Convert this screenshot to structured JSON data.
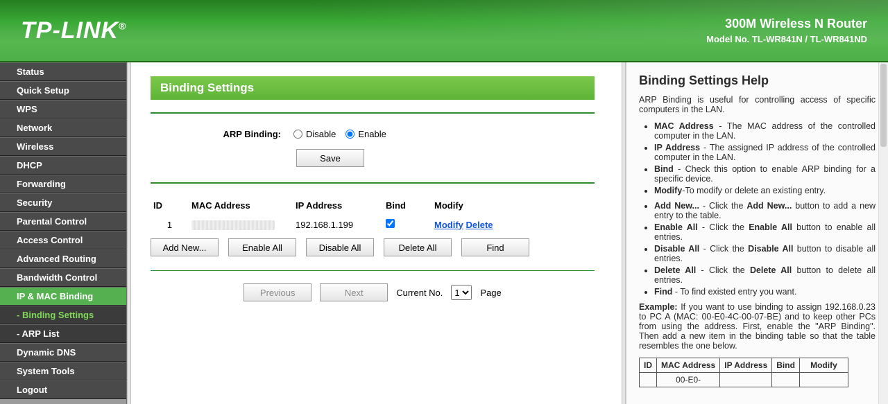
{
  "header": {
    "logo": "TP-LINK",
    "title": "300M Wireless N Router",
    "model": "Model No. TL-WR841N / TL-WR841ND"
  },
  "sidebar": {
    "items": [
      {
        "label": "Status"
      },
      {
        "label": "Quick Setup"
      },
      {
        "label": "WPS"
      },
      {
        "label": "Network"
      },
      {
        "label": "Wireless"
      },
      {
        "label": "DHCP"
      },
      {
        "label": "Forwarding"
      },
      {
        "label": "Security"
      },
      {
        "label": "Parental Control"
      },
      {
        "label": "Access Control"
      },
      {
        "label": "Advanced Routing"
      },
      {
        "label": "Bandwidth Control"
      },
      {
        "label": "IP & MAC Binding"
      },
      {
        "label": "- Binding Settings"
      },
      {
        "label": "- ARP List"
      },
      {
        "label": "Dynamic DNS"
      },
      {
        "label": "System Tools"
      },
      {
        "label": "Logout"
      }
    ]
  },
  "page": {
    "title": "Binding Settings",
    "arp_binding_label": "ARP Binding:",
    "disable_label": "Disable",
    "enable_label": "Enable",
    "save_label": "Save",
    "columns": {
      "id": "ID",
      "mac": "MAC Address",
      "ip": "IP Address",
      "bind": "Bind",
      "modify": "Modify"
    },
    "rows": [
      {
        "id": "1",
        "mac": "",
        "ip": "192.168.1.199",
        "bind": true,
        "modify": "Modify",
        "delete": "Delete"
      }
    ],
    "actions": {
      "add_new": "Add New...",
      "enable_all": "Enable All",
      "disable_all": "Disable All",
      "delete_all": "Delete All",
      "find": "Find"
    },
    "pager": {
      "previous": "Previous",
      "next": "Next",
      "current_no": "Current No.",
      "page": "Page",
      "selected": "1"
    }
  },
  "help": {
    "title": "Binding Settings Help",
    "intro": "ARP Binding is useful for controlling access of specific computers in the LAN.",
    "defs": [
      {
        "term": "MAC Address",
        "text": " - The MAC address of the controlled computer in the LAN."
      },
      {
        "term": "IP Address",
        "text": " - The assigned IP address of the controlled computer in the LAN."
      },
      {
        "term": "Bind",
        "text": " - Check this option to enable ARP binding for a specific device."
      },
      {
        "term": "Modify",
        "text": "-To modify or delete an existing entry."
      }
    ],
    "btns": [
      {
        "term": "Add New...",
        "text": " - Click the ",
        "bold2": "Add New...",
        "tail": " button to add a new entry to the table."
      },
      {
        "term": "Enable All",
        "text": " - Click the ",
        "bold2": "Enable All",
        "tail": " button to enable all entries."
      },
      {
        "term": "Disable All",
        "text": " - Click the ",
        "bold2": "Disable All",
        "tail": " button to disable all entries."
      },
      {
        "term": "Delete All",
        "text": " - Click the ",
        "bold2": "Delete All",
        "tail": " button to delete all entries."
      },
      {
        "term": "Find",
        "text": " - To find existed entry you want.",
        "bold2": "",
        "tail": ""
      }
    ],
    "example_label": "Example:",
    "example_text": " If you want to use binding to assign 192.168.0.23 to PC A (MAC: 00-E0-4C-00-07-BE) and to keep other PCs from using the address. First, enable the \"ARP Binding\". Then add a new item in the binding table so that the table resembles the one below.",
    "table": {
      "cols": {
        "id": "ID",
        "mac": "MAC Address",
        "ip": "IP Address",
        "bind": "Bind",
        "modify": "Modify"
      },
      "row": {
        "id": "",
        "mac": "00-E0-",
        "ip": "",
        "bind": "",
        "modify": ""
      }
    }
  }
}
